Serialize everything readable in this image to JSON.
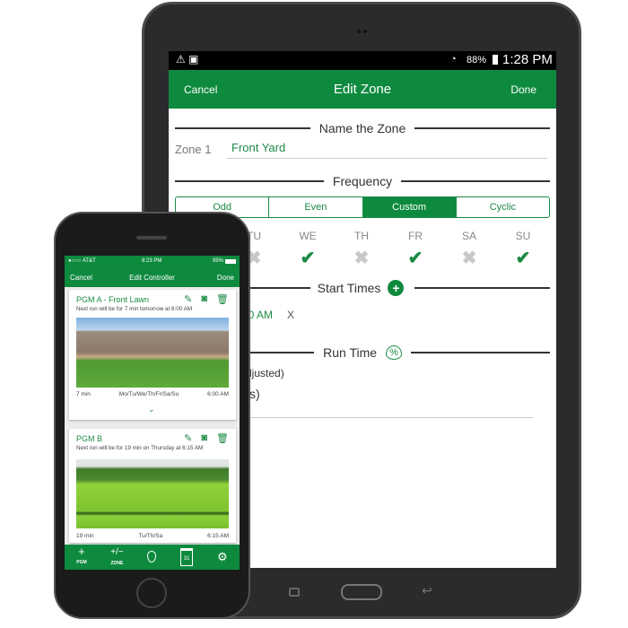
{
  "tablet": {
    "status": {
      "battery": "88%",
      "time": "1:28 PM"
    },
    "header": {
      "cancel": "Cancel",
      "title": "Edit Zone",
      "done": "Done"
    },
    "name_section": {
      "title": "Name the Zone",
      "label": "Zone 1",
      "value": "Front Yard"
    },
    "frequency": {
      "title": "Frequency",
      "options": [
        "Odd",
        "Even",
        "Custom",
        "Cyclic"
      ],
      "selected": "Custom"
    },
    "days": [
      {
        "label": "TU",
        "on": false
      },
      {
        "label": "WE",
        "on": true
      },
      {
        "label": "TH",
        "on": false
      },
      {
        "label": "FR",
        "on": true
      },
      {
        "label": "SA",
        "on": false
      },
      {
        "label": "SU",
        "on": true
      }
    ],
    "start_times": {
      "title": "Start Times",
      "time": "00 AM",
      "remove": "X"
    },
    "run_time": {
      "title": "Run Time",
      "line1": "ljusted)",
      "line2": "s)"
    }
  },
  "phone": {
    "status": {
      "carrier": "AT&T",
      "time": "8:23 PM",
      "battery": "95%"
    },
    "header": {
      "cancel": "Cancel",
      "title": "Edit Controller",
      "done": "Done"
    },
    "programs": [
      {
        "title": "PGM A - Front Lawn",
        "subtitle": "Next run will be for 7 min tomorrow at 6:00 AM",
        "duration": "7 min",
        "days": "Mo/Tu/We/Th/Fr/Sa/Su",
        "time": "6:00 AM"
      },
      {
        "title": "PGM B",
        "subtitle": "Next run will be for 19 min on Thursday at 6:15 AM",
        "duration": "19 min",
        "days": "Tu/Th/Sa",
        "time": "6:15 AM"
      }
    ],
    "tabs": [
      {
        "icon": "+",
        "label": "PGM"
      },
      {
        "icon": "+/−",
        "label": "ZONE"
      },
      {
        "icon": "water-drop-icon"
      },
      {
        "icon": "calendar-icon",
        "label": "31"
      },
      {
        "icon": "gears-icon"
      }
    ]
  },
  "colors": {
    "brand_green": "#0e8a3e"
  }
}
